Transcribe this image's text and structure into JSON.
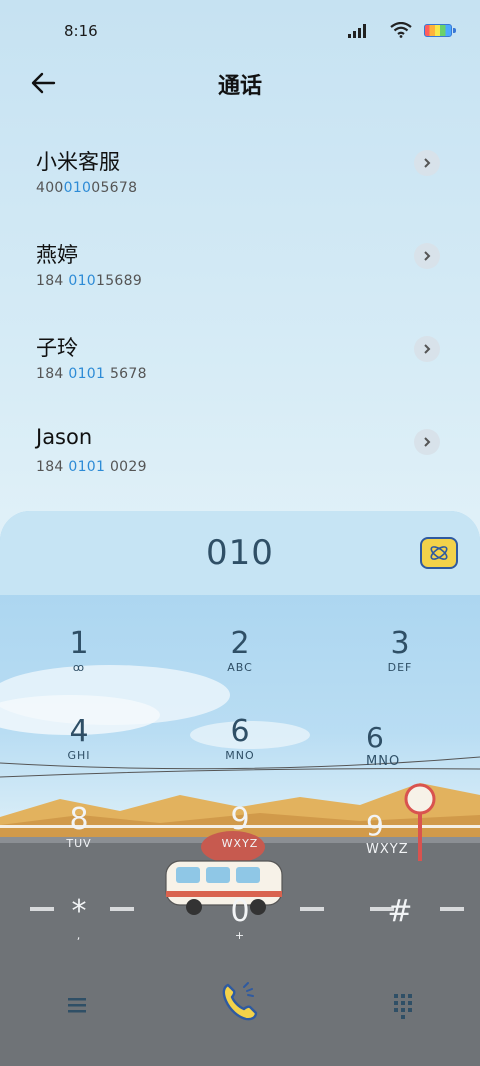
{
  "status": {
    "time": "8:16"
  },
  "header": {
    "title": "通话"
  },
  "contacts": [
    {
      "name": "小米客服",
      "num_pre": "400",
      "num_hl": "010",
      "num_post": "05678"
    },
    {
      "name": "燕婷",
      "num_pre": "184 ",
      "num_hl": "010",
      "num_post": "15689"
    },
    {
      "name": "子玲",
      "num_pre": "184 ",
      "num_hl": "0101",
      "num_post": " 5678"
    },
    {
      "name": "Jason",
      "num_pre": "184 ",
      "num_hl": "0101",
      "num_post": " 0029"
    }
  ],
  "dialer": {
    "display": "010",
    "keys": [
      {
        "d": "1",
        "l": "ꝏ"
      },
      {
        "d": "2",
        "l": "ABC"
      },
      {
        "d": "3",
        "l": "DEF"
      },
      {
        "d": "4",
        "l": "GHI"
      },
      {
        "d": "6",
        "l": "MNO"
      },
      {
        "d": "6",
        "l": "MNO"
      },
      {
        "d": "8",
        "l": "TUV"
      },
      {
        "d": "9",
        "l": "WXYZ"
      },
      {
        "d": "9",
        "l": "WXYZ"
      },
      {
        "d": "*",
        "l": ","
      },
      {
        "d": "0",
        "l": "+"
      },
      {
        "d": "#",
        "l": ""
      }
    ]
  },
  "colors": {
    "accent": "#2d8bd6",
    "key_text": "#2f4f66",
    "call_button": "#f3d24a"
  }
}
